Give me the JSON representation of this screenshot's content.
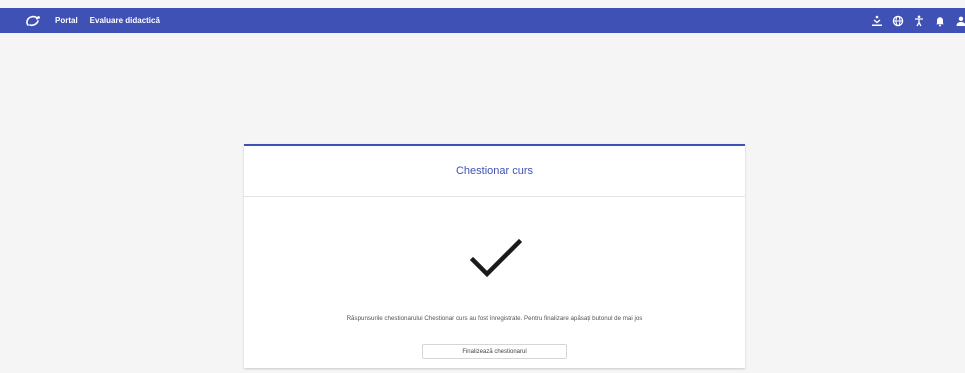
{
  "topbar": {
    "background_color": "#3f51b5",
    "logo_icon": "portal-logo-icon",
    "nav": [
      {
        "label": "Portal"
      },
      {
        "label": "Evaluare didactică"
      }
    ],
    "icons": [
      "accessibility-download-icon",
      "globe-icon",
      "accessibility-person-icon",
      "bell-icon",
      "user-icon"
    ]
  },
  "card": {
    "accent_color": "#3f51b5",
    "title": "Chestionar curs",
    "check_icon": "checkmark-icon",
    "message": "Răspunsurile chestionarului Chestionar curs au fost înregistrate. Pentru finalizare apăsați butonul de mai jos",
    "finish_button": "Finalizează chestionarul"
  }
}
